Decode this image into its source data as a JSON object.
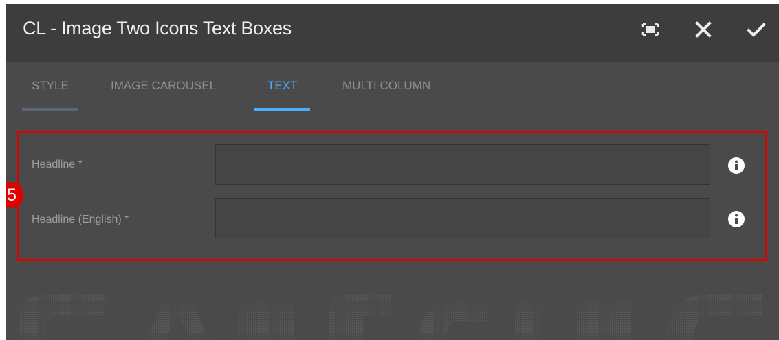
{
  "dialog": {
    "title": "CL - Image Two Icons Text Boxes",
    "buttons": {
      "fullscreen": "fullscreen-icon",
      "close": "close-icon",
      "confirm": "check-icon"
    }
  },
  "tabs": [
    {
      "label": "STYLE",
      "active": false
    },
    {
      "label": "IMAGE CAROUSEL",
      "active": false
    },
    {
      "label": "TEXT",
      "active": true
    },
    {
      "label": "MULTI COLUMN",
      "active": false
    }
  ],
  "annotation": {
    "number": "5",
    "color": "#e10000"
  },
  "fields": [
    {
      "label": "Headline *",
      "value": "",
      "info_icon": "info-icon"
    },
    {
      "label": "Headline (English) *",
      "value": "",
      "info_icon": "info-icon"
    }
  ],
  "colors": {
    "accent": "#4fa9ff",
    "dialog_bg": "#4a4a4a",
    "titlebar_bg": "#3d3d3d",
    "highlight": "#e10000"
  }
}
